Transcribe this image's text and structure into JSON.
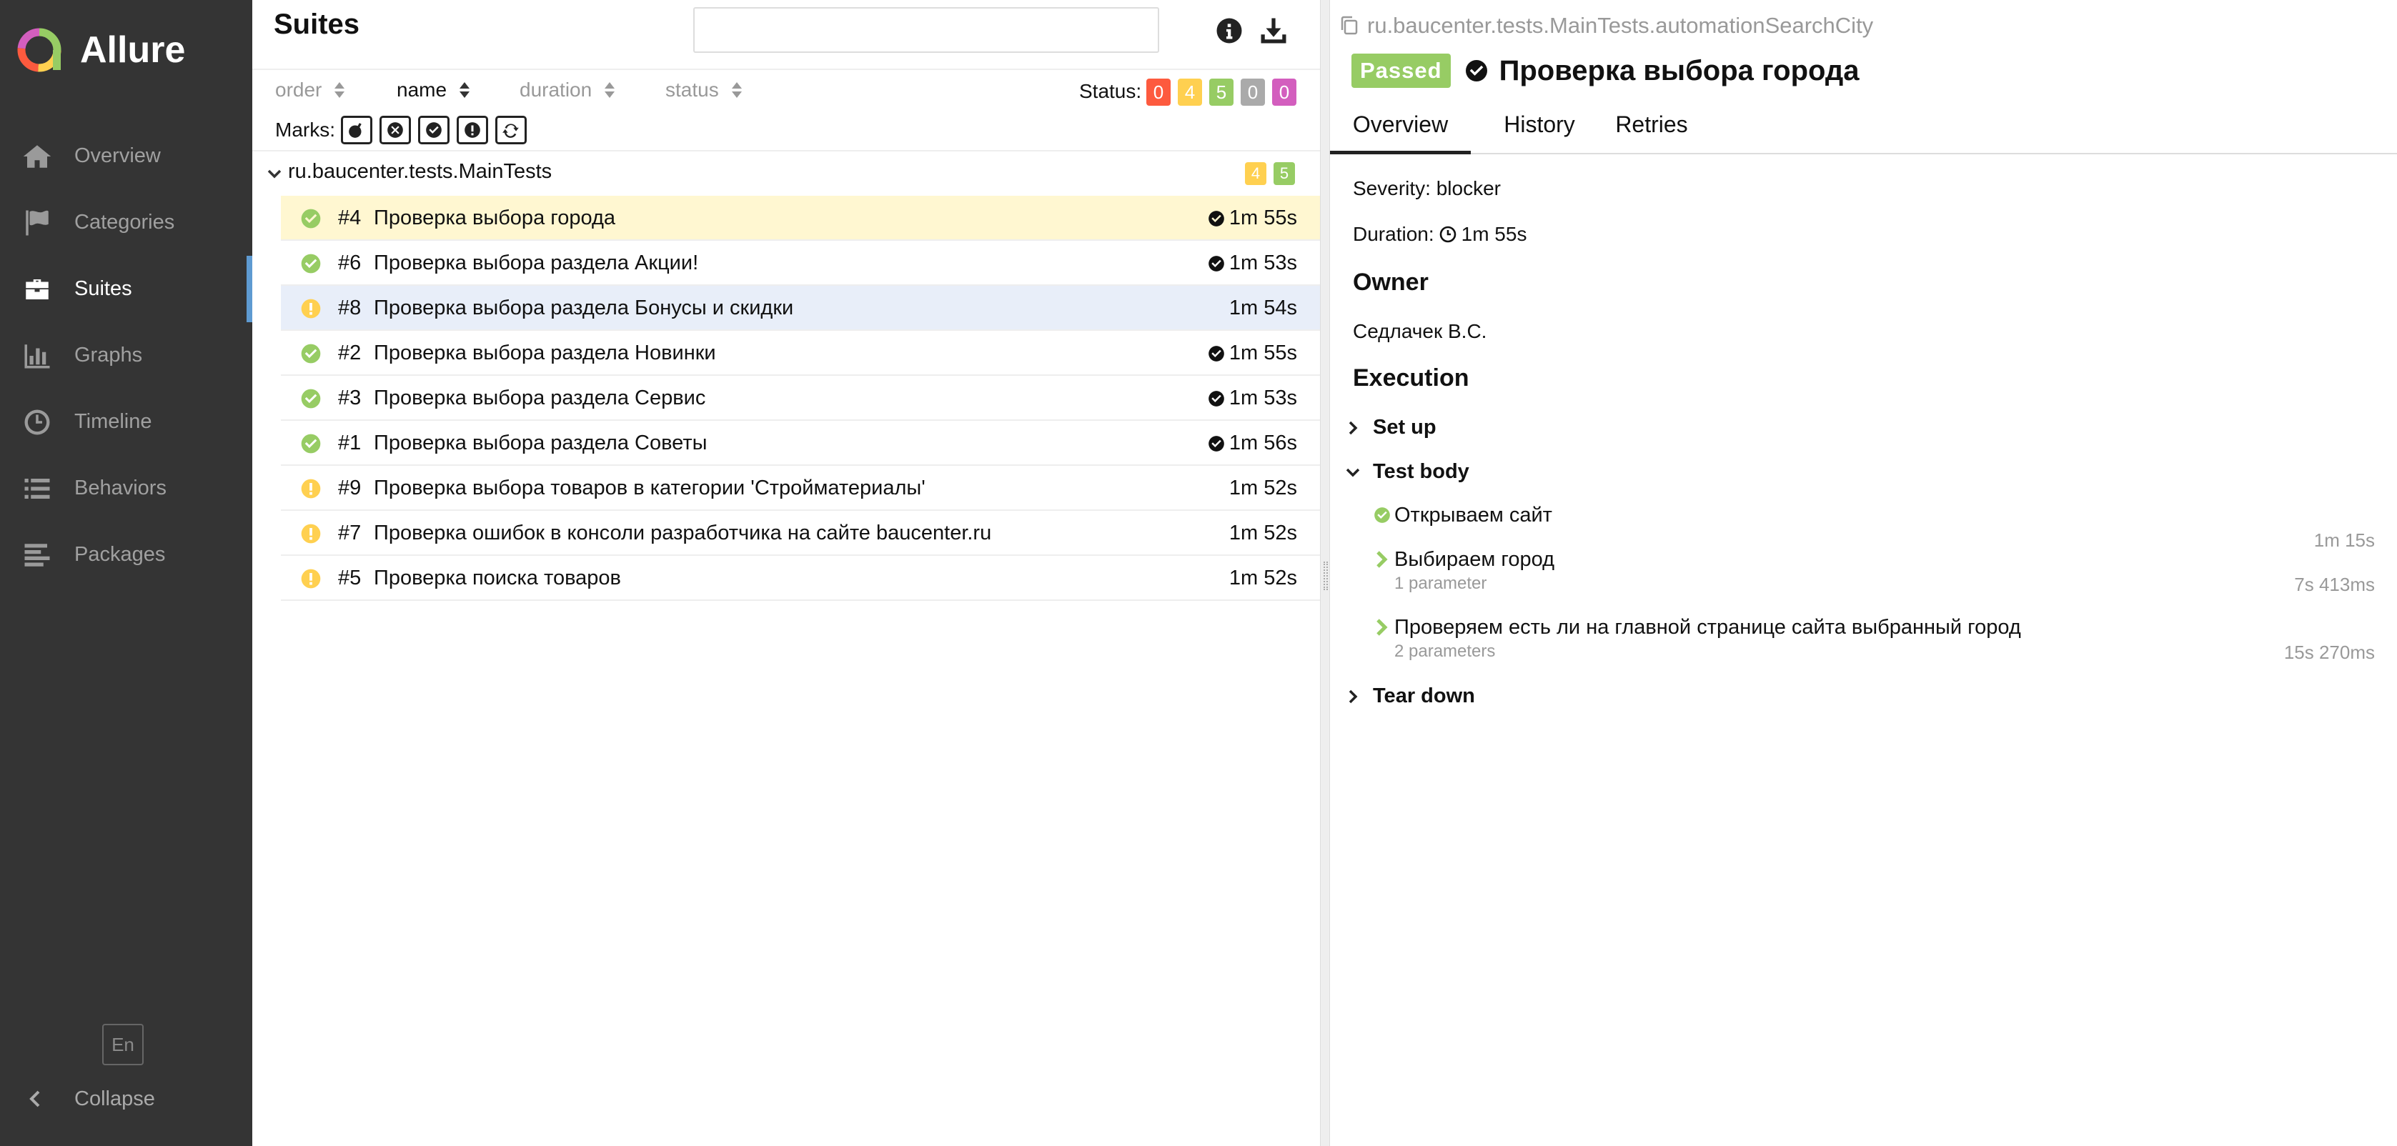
{
  "brand": {
    "name": "Allure"
  },
  "sidebar": {
    "items": [
      {
        "label": "Overview",
        "icon": "home-icon"
      },
      {
        "label": "Categories",
        "icon": "flag-icon"
      },
      {
        "label": "Suites",
        "icon": "briefcase-icon",
        "active": true
      },
      {
        "label": "Graphs",
        "icon": "bar-chart-icon"
      },
      {
        "label": "Timeline",
        "icon": "clock-icon"
      },
      {
        "label": "Behaviors",
        "icon": "list-icon"
      },
      {
        "label": "Packages",
        "icon": "align-left-icon"
      }
    ],
    "language": "En",
    "collapse_label": "Collapse"
  },
  "suites": {
    "title": "Suites",
    "search": {
      "value": "",
      "placeholder": ""
    },
    "sort": {
      "order": "order",
      "name": "name",
      "duration": "duration",
      "status": "status",
      "active": "name"
    },
    "status_label": "Status:",
    "status_counts": [
      {
        "count": "0",
        "color": "#fd5a3e",
        "kind": "failed"
      },
      {
        "count": "4",
        "color": "#ffd050",
        "kind": "broken"
      },
      {
        "count": "5",
        "color": "#97cc64",
        "kind": "passed"
      },
      {
        "count": "0",
        "color": "#aaaaaa",
        "kind": "skipped"
      },
      {
        "count": "0",
        "color": "#d35ebe",
        "kind": "unknown"
      }
    ],
    "marks_label": "Marks:",
    "group": {
      "name": "ru.baucenter.tests.MainTests",
      "broken": "4",
      "passed": "5"
    },
    "tests": [
      {
        "num": "#4",
        "name": "Проверка выбора города",
        "duration": "1m 55s",
        "status": "passed",
        "flag": true,
        "state": "selected"
      },
      {
        "num": "#6",
        "name": "Проверка выбора раздела Акции!",
        "duration": "1m 53s",
        "status": "passed",
        "flag": true,
        "state": ""
      },
      {
        "num": "#8",
        "name": "Проверка выбора раздела Бонусы и скидки",
        "duration": "1m 54s",
        "status": "broken",
        "flag": false,
        "state": "hover"
      },
      {
        "num": "#2",
        "name": "Проверка выбора раздела Новинки",
        "duration": "1m 55s",
        "status": "passed",
        "flag": true,
        "state": ""
      },
      {
        "num": "#3",
        "name": "Проверка выбора раздела Сервис",
        "duration": "1m 53s",
        "status": "passed",
        "flag": true,
        "state": ""
      },
      {
        "num": "#1",
        "name": "Проверка выбора раздела Советы",
        "duration": "1m 56s",
        "status": "passed",
        "flag": true,
        "state": ""
      },
      {
        "num": "#9",
        "name": "Проверка выбора товаров в категории 'Стройматериалы'",
        "duration": "1m 52s",
        "status": "broken",
        "flag": false,
        "state": ""
      },
      {
        "num": "#7",
        "name": "Проверка ошибок в консоли разработчика на сайте baucenter.ru",
        "duration": "1m 52s",
        "status": "broken",
        "flag": false,
        "state": ""
      },
      {
        "num": "#5",
        "name": "Проверка поиска товаров",
        "duration": "1m 52s",
        "status": "broken",
        "flag": false,
        "state": ""
      }
    ]
  },
  "details": {
    "breadcrumb": "ru.baucenter.tests.MainTests.automationSearchCity",
    "status_badge": "Passed",
    "title": "Проверка выбора города",
    "tabs": [
      "Overview",
      "History",
      "Retries"
    ],
    "severity": "Severity: blocker",
    "duration_label": "Duration:",
    "duration_value": "1m 55s",
    "owner_heading": "Owner",
    "owner": "Седлачек В.С.",
    "execution_heading": "Execution",
    "setup_label": "Set up",
    "body_label": "Test body",
    "teardown_label": "Tear down",
    "steps": [
      {
        "name": "Открываем сайт",
        "params": "",
        "duration": "1m 15s"
      },
      {
        "name": "Выбираем город",
        "params": "1 parameter",
        "duration": "7s 413ms"
      },
      {
        "name": "Проверяем есть ли на главной странице сайта выбранный город",
        "params": "2 parameters",
        "duration": "15s 270ms"
      }
    ]
  },
  "colors": {
    "passed": "#97cc64",
    "broken": "#ffd050",
    "sidebar_bg": "#343434",
    "accent": "#5e9ad1"
  }
}
